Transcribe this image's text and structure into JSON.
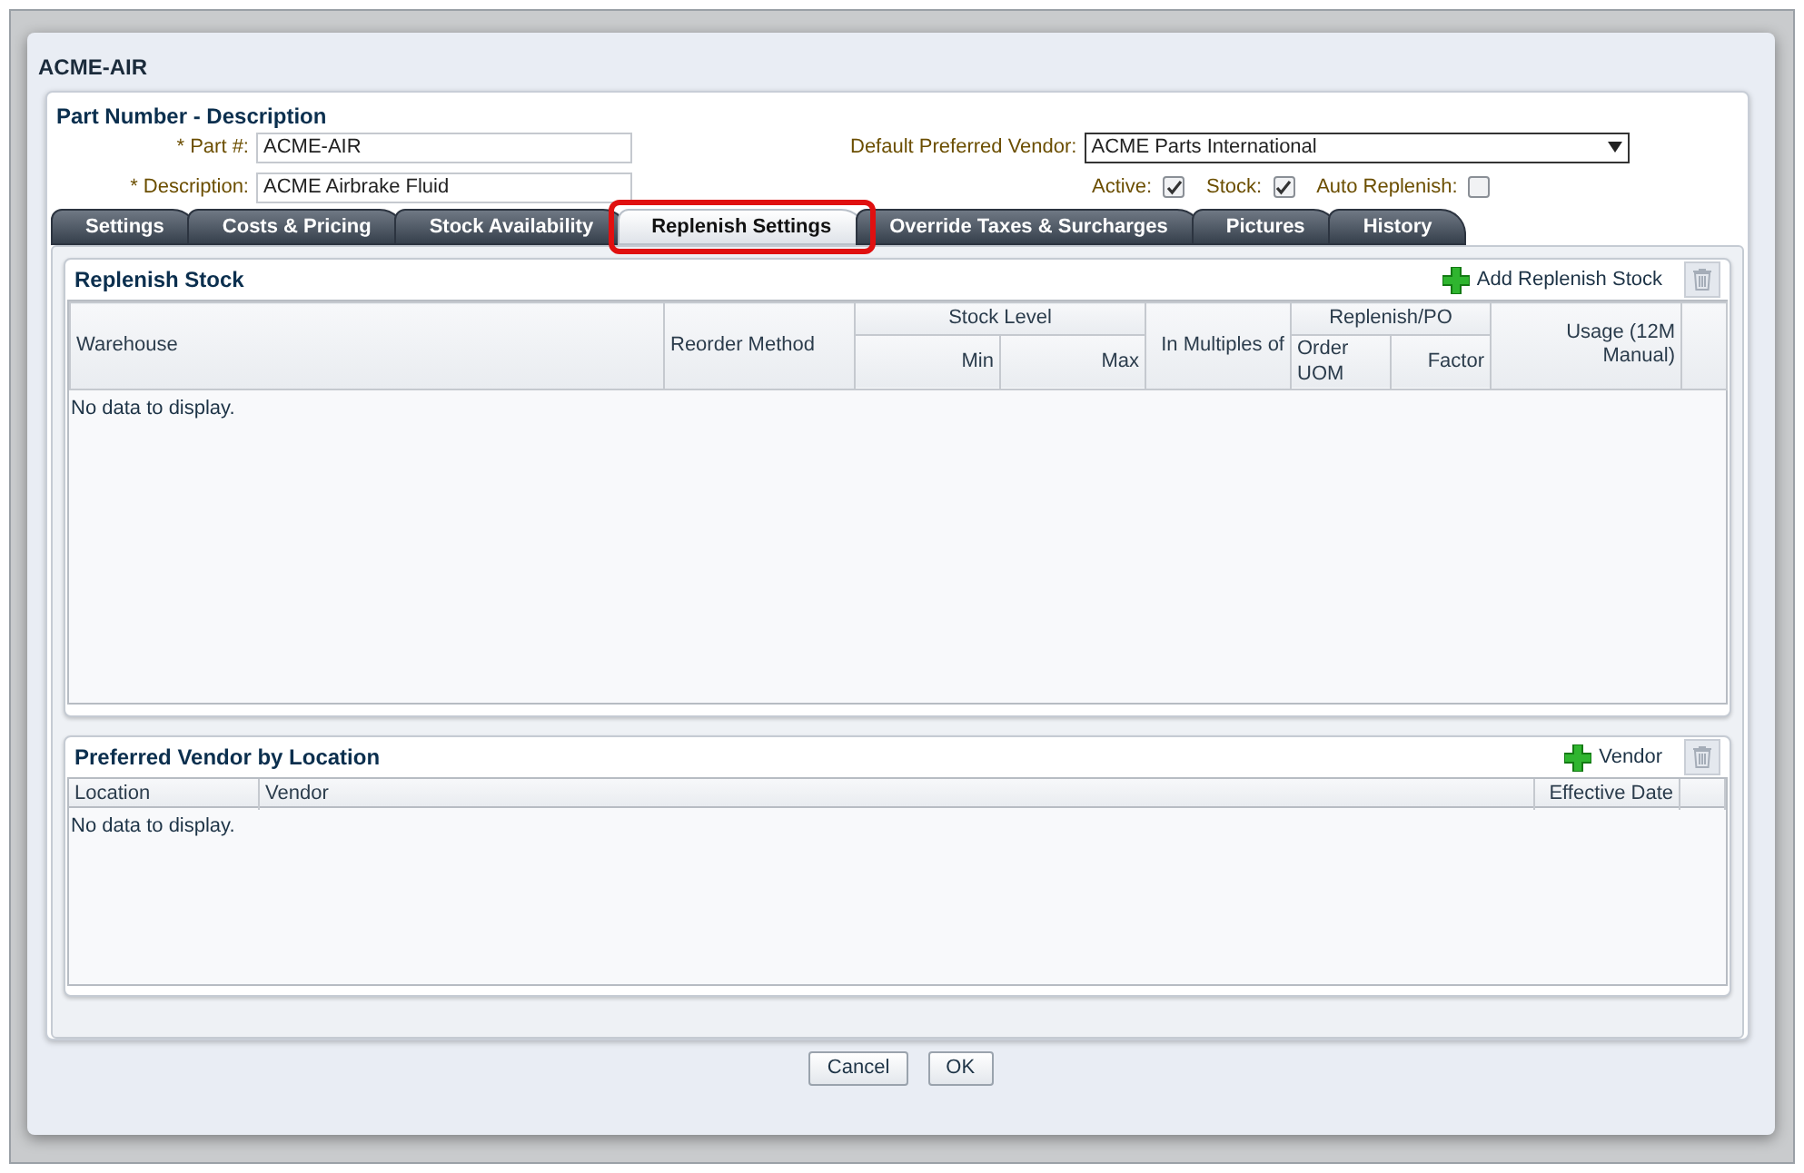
{
  "dialog": {
    "title": "ACME-AIR"
  },
  "part_panel": {
    "title": "Part Number - Description",
    "fields": [
      {
        "label": "* Part #:",
        "value": "ACME-AIR"
      },
      {
        "label": "* Description:",
        "value": "ACME Airbrake Fluid"
      }
    ],
    "vendor": {
      "label": "Default Preferred Vendor:",
      "value": "ACME Parts International"
    },
    "checkboxes": [
      {
        "label": "Active:",
        "checked": true
      },
      {
        "label": "Stock:",
        "checked": true
      },
      {
        "label": "Auto Replenish:",
        "checked": false
      }
    ]
  },
  "tabs": [
    {
      "label": "Settings",
      "selected": false
    },
    {
      "label": "Costs & Pricing",
      "selected": false
    },
    {
      "label": "Stock Availability",
      "selected": false
    },
    {
      "label": "Replenish Settings",
      "selected": true
    },
    {
      "label": "Override Taxes & Surcharges",
      "selected": false
    },
    {
      "label": "Pictures",
      "selected": false
    },
    {
      "label": "History",
      "selected": false
    }
  ],
  "replenish_stock": {
    "title": "Replenish Stock",
    "add_button": "Add Replenish Stock",
    "columns": {
      "warehouse": "Warehouse",
      "reorder_method": "Reorder Method",
      "stock_level": "Stock Level",
      "min": "Min",
      "max": "Max",
      "in_multiples_of": "In Multiples of",
      "replenish_po": "Replenish/PO",
      "order_uom": "Order UOM",
      "factor": "Factor",
      "usage": "Usage (12M Manual)"
    },
    "empty_text": "No data to display."
  },
  "preferred_vendor": {
    "title": "Preferred Vendor by Location",
    "add_button": "Vendor",
    "columns": [
      "Location",
      "Vendor",
      "Effective Date"
    ],
    "empty_text": "No data to display."
  },
  "buttons": [
    "Cancel",
    "OK"
  ]
}
